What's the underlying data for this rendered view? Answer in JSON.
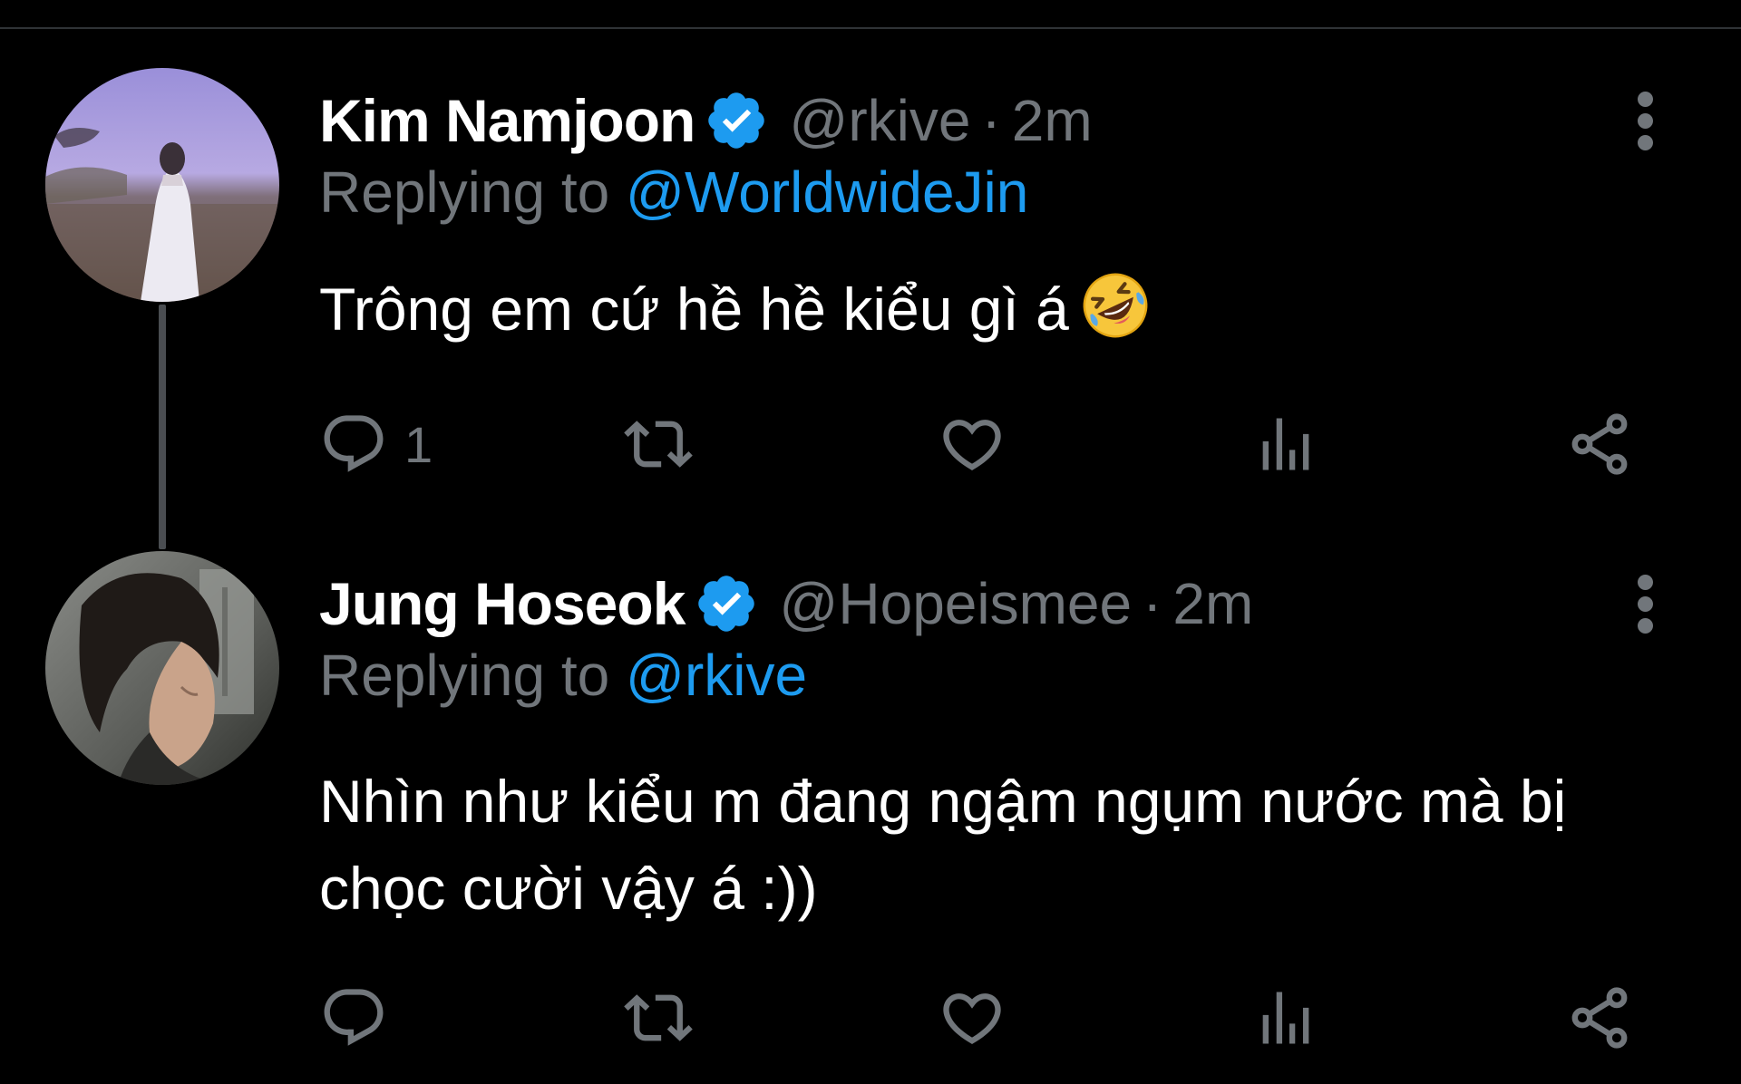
{
  "tweets": [
    {
      "name": "Kim Namjoon",
      "handle": "@rkive",
      "separator": "·",
      "time": "2m",
      "replying_prefix": "Replying to",
      "replying_to": "@WorldwideJin",
      "text": "Trông em cứ hề hề kiểu gì á",
      "text_line2": "",
      "emoji": "rolling-on-floor-laughing-emoji",
      "reply_count": "1",
      "retweet_count": "",
      "like_count": "",
      "view_count": ""
    },
    {
      "name": "Jung Hoseok",
      "handle": "@Hopeismee",
      "separator": "·",
      "time": "2m",
      "replying_prefix": "Replying to",
      "replying_to": "@rkive",
      "text": "Nhìn như kiểu m đang ngậm ngụm nước mà bị",
      "text_line2": "chọc cười vậy á :))",
      "reply_count": "",
      "retweet_count": "",
      "like_count": "",
      "view_count": ""
    }
  ],
  "colors": {
    "background": "#000000",
    "name": "#ffffff",
    "secondary": "#71767b",
    "link": "#1d9bf0",
    "verified": "#1d9bf0",
    "thread_line": "#4a4d51"
  },
  "icons": {
    "reply": "reply-icon",
    "retweet": "retweet-icon",
    "like": "heart-icon",
    "views": "analytics-icon",
    "share": "share-icon",
    "more": "more-vertical-icon",
    "verified": "verified-badge-icon"
  }
}
